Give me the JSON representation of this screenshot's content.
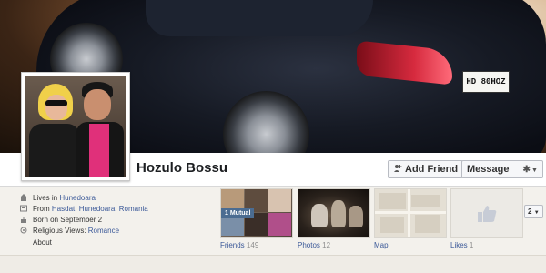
{
  "profile": {
    "name": "Hozulo Bossu",
    "cover_plate": "HD 80HOZ"
  },
  "actions": {
    "add_friend_label": "Add Friend",
    "message_label": "Message",
    "more_count": "2"
  },
  "info": {
    "lives_prefix": "Lives in ",
    "lives_link": "Hunedoara",
    "from_prefix": "From ",
    "from_link": "Hasdat, Hunedoara, Romania",
    "born": "Born on September 2",
    "religious_prefix": "Religious Views: ",
    "religious_link": "Romance",
    "about": "About"
  },
  "tiles": {
    "friends": {
      "label": "Friends",
      "count": "149",
      "badge": "1 Mutual"
    },
    "photos": {
      "label": "Photos",
      "count": "12"
    },
    "map": {
      "label": "Map"
    },
    "likes": {
      "label": "Likes",
      "count": "1"
    }
  },
  "colors": {
    "link": "#3b5998",
    "badge": "#4b6c91"
  },
  "icons": [
    "home-icon",
    "location-icon",
    "birthday-icon",
    "religion-icon",
    "add-friend-icon",
    "gear-icon",
    "chevron-down-icon",
    "like-thumb-icon"
  ]
}
